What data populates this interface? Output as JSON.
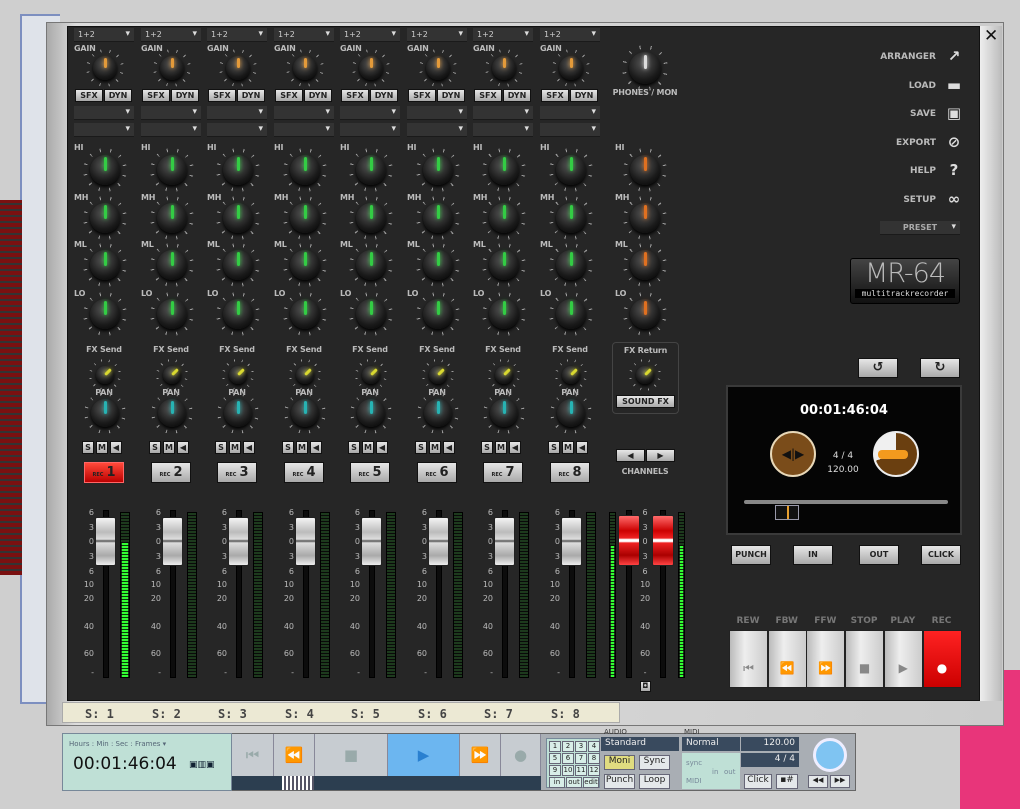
{
  "channels": [
    {
      "input": "1+2",
      "rec": "1",
      "strip": "S: 1",
      "armed": true,
      "meter": 0.82
    },
    {
      "input": "1+2",
      "rec": "2",
      "strip": "S: 2",
      "armed": false,
      "meter": 0
    },
    {
      "input": "1+2",
      "rec": "3",
      "strip": "S: 3",
      "armed": false,
      "meter": 0
    },
    {
      "input": "1+2",
      "rec": "4",
      "strip": "S: 4",
      "armed": false,
      "meter": 0
    },
    {
      "input": "1+2",
      "rec": "5",
      "strip": "S: 5",
      "armed": false,
      "meter": 0
    },
    {
      "input": "1+2",
      "rec": "6",
      "strip": "S: 6",
      "armed": false,
      "meter": 0
    },
    {
      "input": "1+2",
      "rec": "7",
      "strip": "S: 7",
      "armed": false,
      "meter": 0
    },
    {
      "input": "1+2",
      "rec": "8",
      "strip": "S: 8",
      "armed": false,
      "meter": 0
    }
  ],
  "labels": {
    "gain": "GAIN",
    "sfx": "SFX",
    "dyn": "DYN",
    "hi": "HI",
    "mh": "MH",
    "ml": "ML",
    "lo": "LO",
    "fx_send": "FX Send",
    "pan": "PAN",
    "solo": "S",
    "mute": "M",
    "rec_prefix": "REC",
    "phones": "PHONES / MON",
    "fx_return": "FX Return",
    "sound_fx": "SOUND FX",
    "channels": "CHANNELS"
  },
  "scale": [
    "6",
    "3",
    "0",
    "3",
    "6",
    "10",
    "20",
    "40",
    "60",
    "-"
  ],
  "menu": [
    {
      "label": "ARRANGER",
      "icon": "↗"
    },
    {
      "label": "LOAD",
      "icon": "▬"
    },
    {
      "label": "SAVE",
      "icon": "▣"
    },
    {
      "label": "EXPORT",
      "icon": "⊘"
    },
    {
      "label": "HELP",
      "icon": "?"
    },
    {
      "label": "SETUP",
      "icon": "∞"
    }
  ],
  "preset": "PRESET",
  "logo": {
    "title": "MR-64",
    "subtitle": "multitrackrecorder"
  },
  "display": {
    "time": "00:01:46:04",
    "signature": "4 / 4",
    "tempo": "120.00",
    "position": 0.15
  },
  "buttons": {
    "punch": "PUNCH",
    "in": "IN",
    "out": "OUT",
    "click": "CLICK"
  },
  "transport": [
    {
      "label": "REW",
      "icon": "⏮"
    },
    {
      "label": "FBW",
      "icon": "⏪"
    },
    {
      "label": "FFW",
      "icon": "⏩"
    },
    {
      "label": "STOP",
      "icon": "■"
    },
    {
      "label": "PLAY",
      "icon": "▶"
    },
    {
      "label": "REC",
      "icon": "●"
    }
  ],
  "host": {
    "time_format": "Hours : Min : Sec : Frames ▾",
    "time": "00:01:46:04",
    "grid": [
      "1",
      "2",
      "3",
      "4",
      "5",
      "6",
      "7",
      "8",
      "9",
      "10",
      "11",
      "12",
      "in",
      "out",
      "edit"
    ],
    "audio_label": "AUDIO",
    "audio_mode": "Standard",
    "moni": "Moni",
    "sync": "Sync",
    "punch": "Punch",
    "loop": "Loop",
    "midi_label": "MIDI",
    "midi_mode": "Normal",
    "sync_lbl": "sync",
    "midi_lbl": "MIDI",
    "in": "in",
    "out": "out",
    "bpm": "120.00",
    "sig": "4 / 4",
    "click": "Click"
  },
  "colors": {
    "eq": "#33cc44",
    "gain": "#e39a3a",
    "fxsend": "#d8d830",
    "pan": "#27b3b3",
    "ret": "#e07020",
    "rec": "#e21b1b"
  }
}
